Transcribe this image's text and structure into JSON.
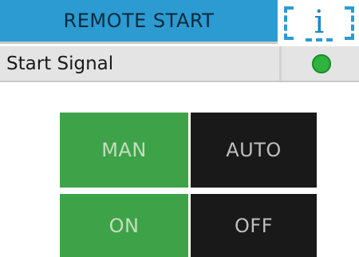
{
  "header": {
    "title": "REMOTE START",
    "info_label": "i"
  },
  "status": {
    "label": "Start Signal",
    "indicator_color": "#2db33e"
  },
  "controls": {
    "mode": {
      "options": [
        "MAN",
        "AUTO"
      ],
      "selected": "MAN"
    },
    "power": {
      "options": [
        "ON",
        "OFF"
      ],
      "selected": "ON"
    }
  },
  "colors": {
    "header_blue": "#2b9bd2",
    "active_green": "#3ea348",
    "inactive_black": "#191919"
  }
}
